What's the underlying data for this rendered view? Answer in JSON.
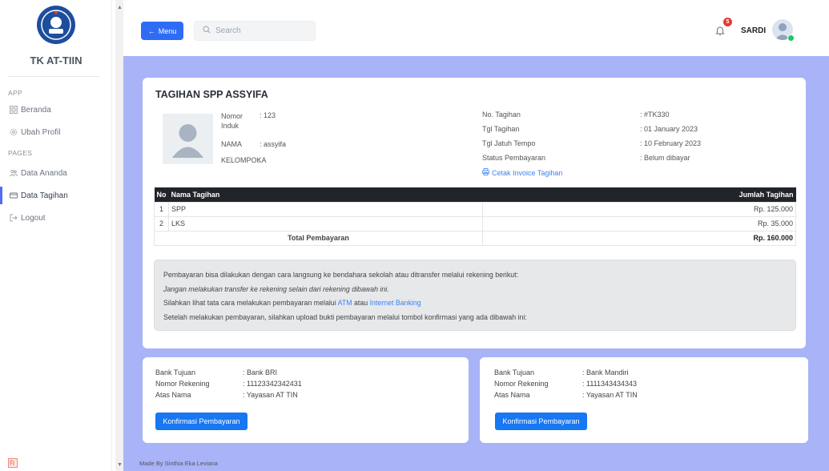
{
  "sidebar": {
    "brand": "TK AT-TIIN",
    "section_app": "APP",
    "section_pages": "PAGES",
    "items": [
      {
        "label": "Beranda",
        "icon": "grid-icon"
      },
      {
        "label": "Ubah Profil",
        "icon": "gear-icon"
      },
      {
        "label": "Data Ananda",
        "icon": "users-icon"
      },
      {
        "label": "Data Tagihan",
        "icon": "card-icon",
        "active": true
      },
      {
        "label": "Logout",
        "icon": "logout-icon"
      }
    ]
  },
  "topbar": {
    "menu_label": "Menu",
    "search_placeholder": "Search",
    "notification_count": "5",
    "username": "SARDI"
  },
  "invoice": {
    "title": "TAGIHAN SPP ASSYIFA",
    "student": {
      "nomor_induk_label": "Nomor Induk",
      "nomor_induk_value": ": 123",
      "nama_label": "NAMA",
      "nama_value": ": assyifa",
      "kelompok_label": "KELOMPOK",
      "kelompok_value": ": A"
    },
    "details": {
      "no_tagihan_label": "No. Tagihan",
      "no_tagihan_value": ": #TK330",
      "tgl_tagihan_label": "Tgl Tagihan",
      "tgl_tagihan_value": ": 01 January 2023",
      "tgl_jatuh_tempo_label": "Tgl Jatuh Tempo",
      "tgl_jatuh_tempo_value": ": 10 February 2023",
      "status_label": "Status Pembayaran",
      "status_value": ": Belum dibayar",
      "print_link": "Cetak Invoice Tagihan"
    },
    "table": {
      "headers": {
        "no": "No",
        "nama": "Nama Tagihan",
        "jumlah": "Jumlah Tagihan"
      },
      "rows": [
        {
          "no": "1",
          "nama": "SPP",
          "jumlah": "Rp. 125.000"
        },
        {
          "no": "2",
          "nama": "LKS",
          "jumlah": "Rp. 35.000"
        }
      ],
      "total_label": "Total Pembayaran",
      "total_value": "Rp. 160.000"
    },
    "note": {
      "line1": "Pembayaran bisa dilakukan dengan cara langsung ke bendahara sekolah atau ditransfer melalui rekening berikut:",
      "line2": "Jangan melakukan transfer ke rekening selain dari rekening dibawah ini.",
      "line3_prefix": "Silahkan lihat tata cara melakukan pembayaran melalui",
      "line3_link1": "ATM",
      "line3_mid": "atau",
      "line3_link2": "Internet Banking",
      "line4": "Setelah melakukan pembayaran, silahkan upload bukti pembayaran melalui tombol konfirmasi yang ada dibawah ini:"
    }
  },
  "banks": [
    {
      "tujuan_label": "Bank Tujuan",
      "tujuan_value": ": Bank BRI",
      "rekening_label": "Nomor Rekening",
      "rekening_value": ": 11123342342431",
      "atas_nama_label": "Atas Nama",
      "atas_nama_value": ": Yayasan AT TIN",
      "button_label": "Konfirmasi Pembayaran"
    },
    {
      "tujuan_label": "Bank Tujuan",
      "tujuan_value": ": Bank Mandiri",
      "rekening_label": "Nomor Rekening",
      "rekening_value": ": 1111343434343",
      "atas_nama_label": "Atas Nama",
      "atas_nama_value": ": Yayasan AT TIN",
      "button_label": "Konfirmasi Pembayaran"
    }
  ],
  "footer": {
    "text": "Made By Sinthia Eka Leviana"
  },
  "colors": {
    "accent": "#2f6cf6",
    "main_bg": "#a8b3f8",
    "table_header": "#212429",
    "online": "#22c55e",
    "badge": "#e53935"
  }
}
